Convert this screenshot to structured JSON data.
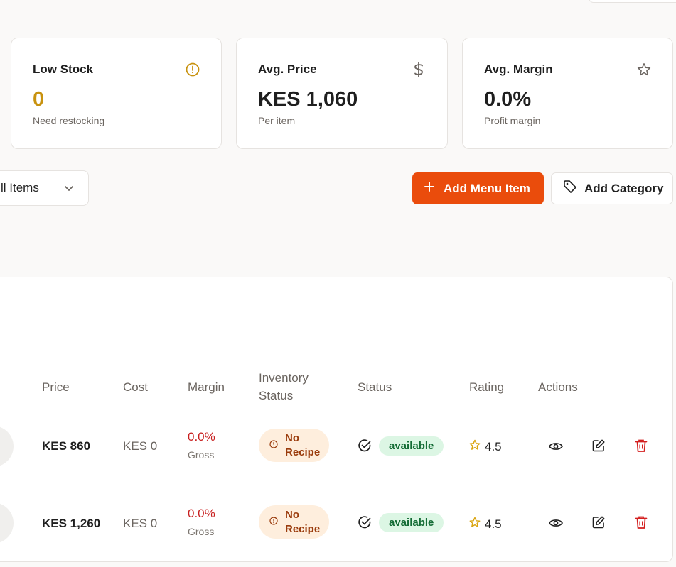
{
  "colors": {
    "accent": "#ea4c0c",
    "warning": "#c8920f",
    "danger": "#c81e1e",
    "success_bg": "#dcf6e4",
    "success_text": "#146c35"
  },
  "stats": [
    {
      "title": "Low Stock",
      "value": "0",
      "sub": "Need restocking",
      "icon": "alert-circle-icon"
    },
    {
      "title": "Avg. Price",
      "value": "KES 1,060",
      "sub": "Per item",
      "icon": "dollar-icon"
    },
    {
      "title": "Avg. Margin",
      "value": "0.0%",
      "sub": "Profit margin",
      "icon": "star-icon"
    }
  ],
  "controls": {
    "filter_value": "ll Items",
    "add_item_label": "Add Menu Item",
    "add_category_label": "Add Category"
  },
  "table": {
    "headers": {
      "price": "Price",
      "cost": "Cost",
      "margin": "Margin",
      "inventory_line1": "Inventory",
      "inventory_line2": "Status",
      "status": "Status",
      "rating": "Rating",
      "actions": "Actions"
    },
    "rows": [
      {
        "price": "KES 860",
        "cost": "KES 0",
        "margin": "0.0%",
        "margin_sub": "Gross",
        "inventory_line1": "No",
        "inventory_line2": "Recipe",
        "status": "available",
        "rating": "4.5"
      },
      {
        "price": "KES 1,260",
        "cost": "KES 0",
        "margin": "0.0%",
        "margin_sub": "Gross",
        "inventory_line1": "No",
        "inventory_line2": "Recipe",
        "status": "available",
        "rating": "4.5"
      }
    ]
  }
}
